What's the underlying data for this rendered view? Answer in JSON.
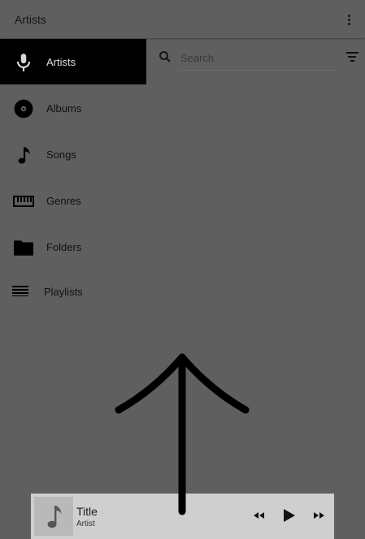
{
  "appbar": {
    "title": "Artists",
    "more_icon": "more-vert-icon"
  },
  "nav": [
    {
      "label": "Artists",
      "icon": "mic-icon",
      "active": true
    },
    {
      "label": "Albums",
      "icon": "album-disc-icon",
      "active": false
    },
    {
      "label": "Songs",
      "icon": "music-note-icon",
      "active": false
    },
    {
      "label": "Genres",
      "icon": "piano-keys-icon",
      "active": false
    },
    {
      "label": "Folders",
      "icon": "folder-icon",
      "active": false
    },
    {
      "label": "Playlists",
      "icon": "playlist-icon",
      "active": false
    }
  ],
  "search": {
    "placeholder": "Search",
    "value": ""
  },
  "player": {
    "title": "Title",
    "artist": "Artist",
    "controls": [
      "rewind-icon",
      "play-icon",
      "fast-forward-icon"
    ]
  },
  "overlay": {
    "gesture": "swipe-up-arrow"
  },
  "colors": {
    "background": "#5f5f5f",
    "active_nav": "#000000",
    "player_bg": "#cfcfcf"
  }
}
